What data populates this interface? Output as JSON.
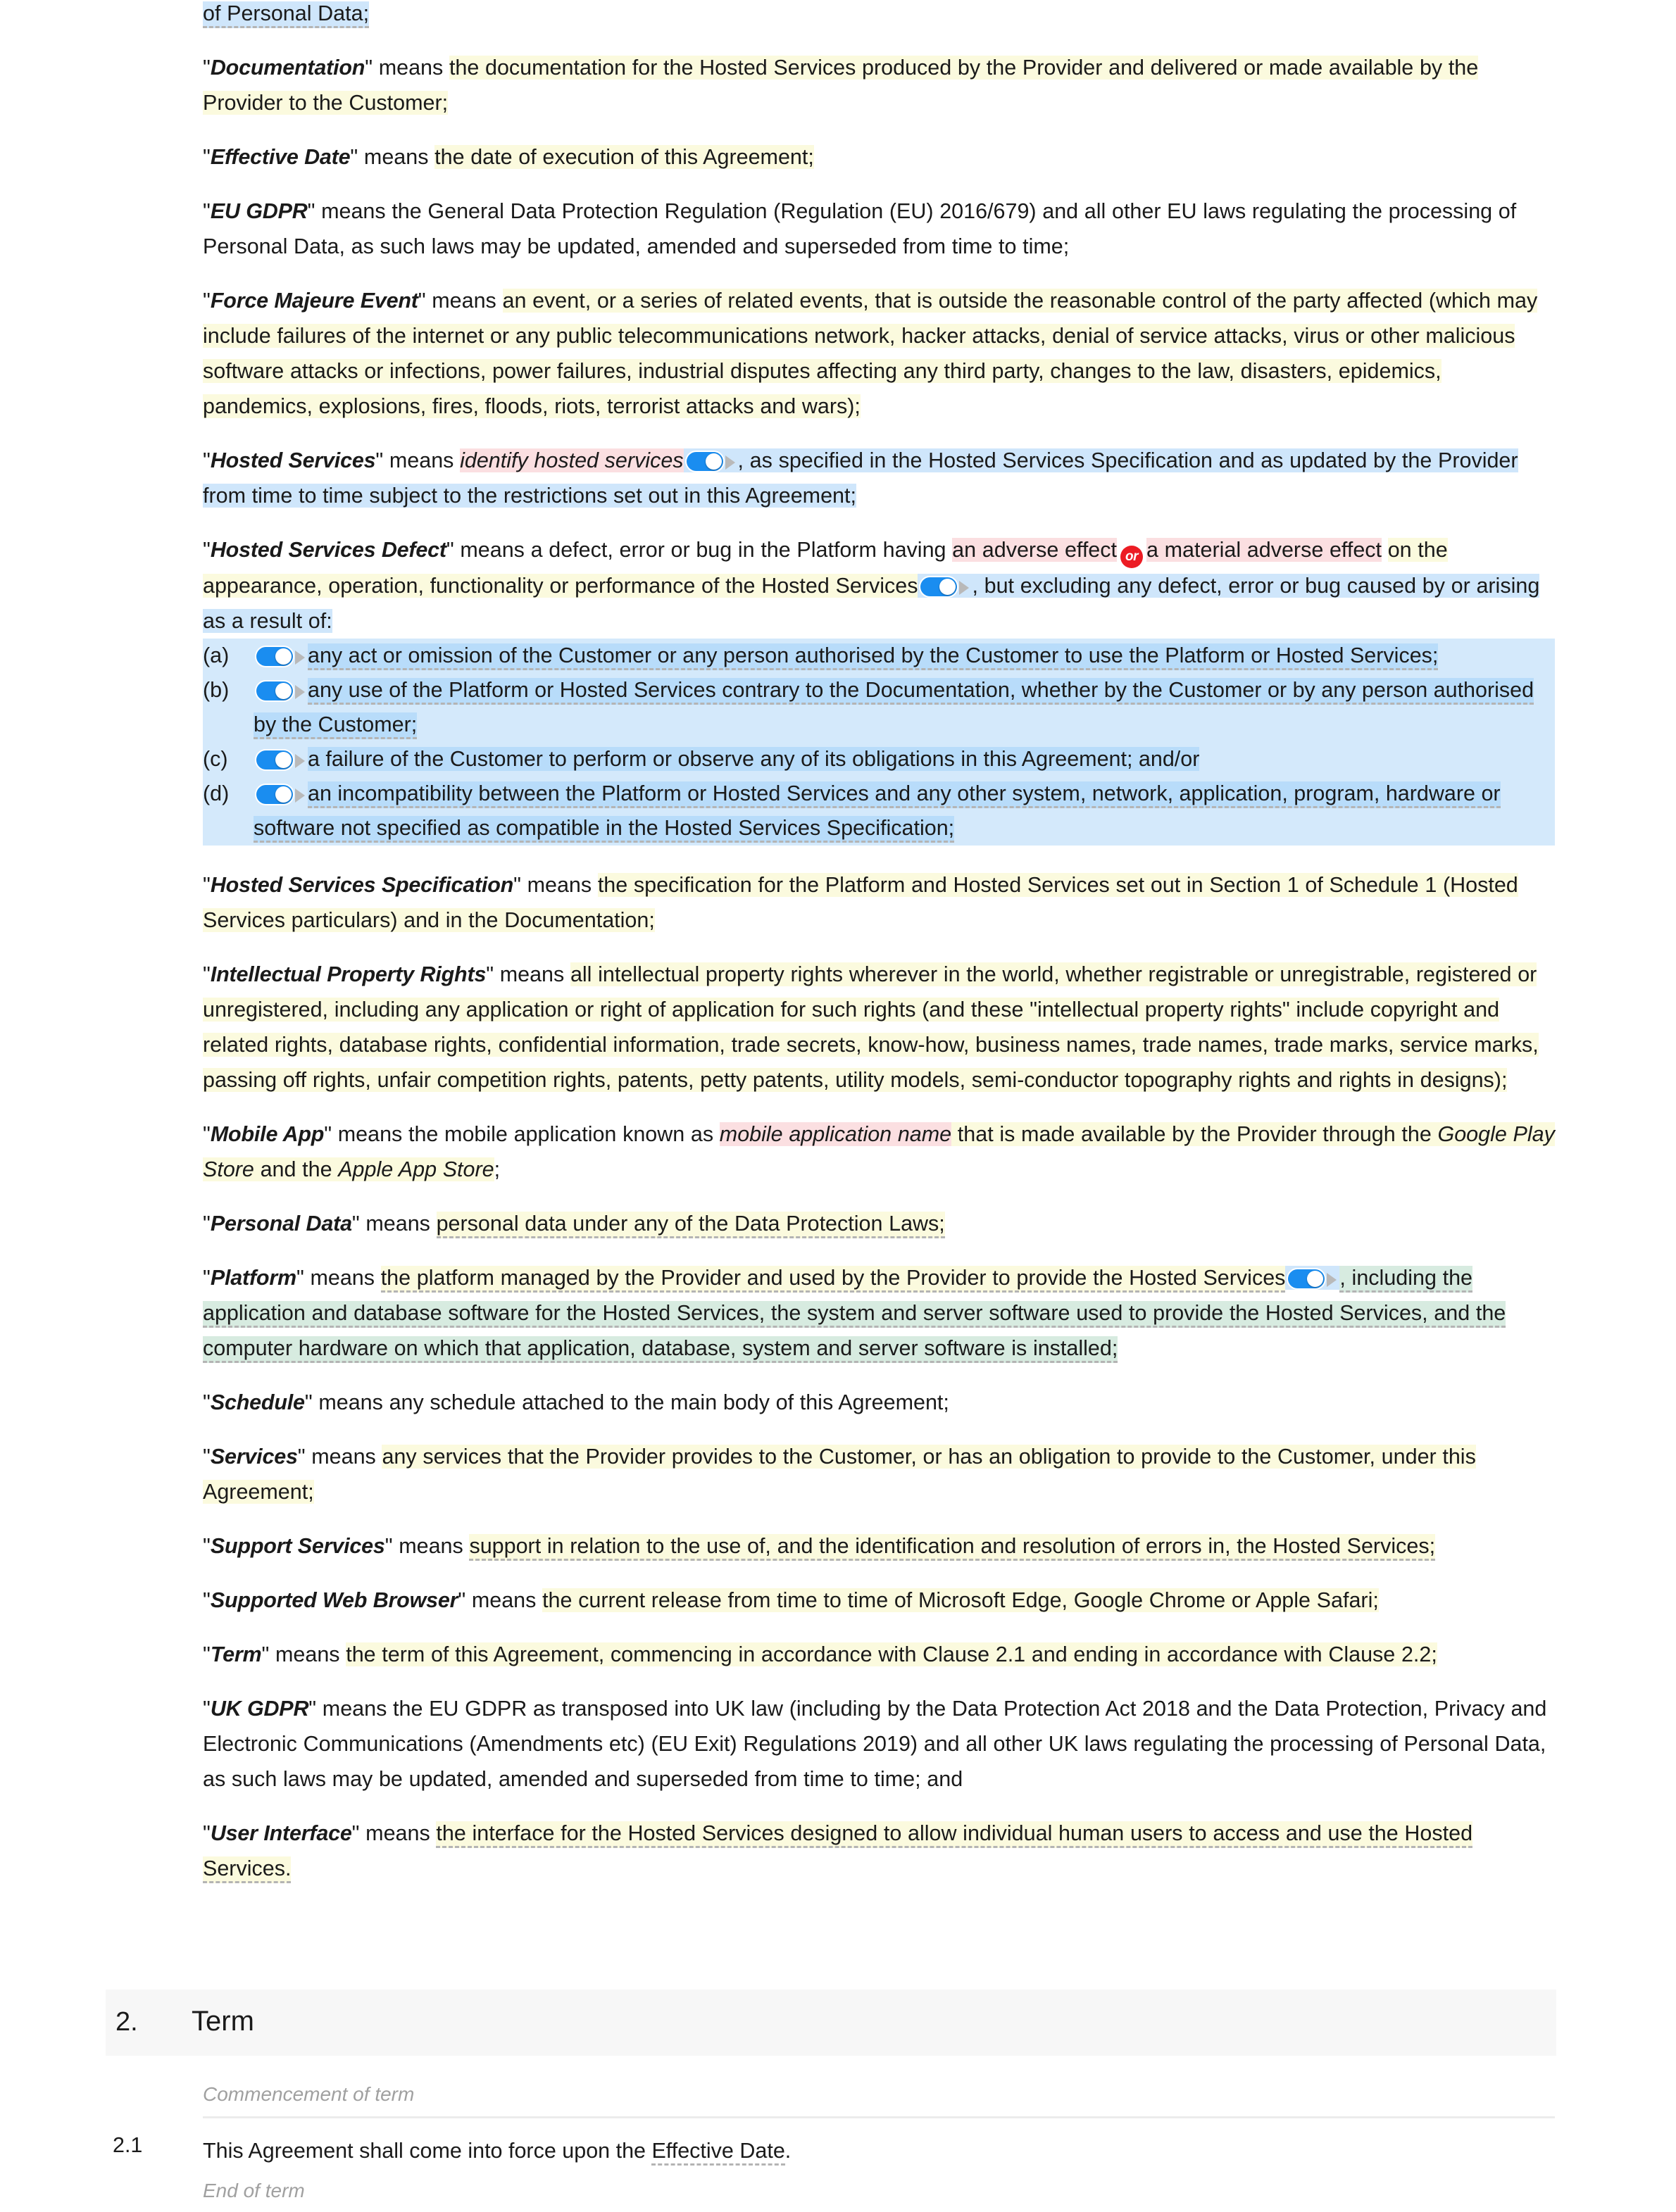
{
  "document": {
    "type": "legal-agreement-definitions",
    "continued_fragment": "of Personal Data;"
  },
  "definitions": [
    {
      "id": "documentation",
      "term": "Documentation",
      "lead": "\" means ",
      "text": "the documentation for the Hosted Services produced by the Provider and delivered or made available by the Provider to the Customer;"
    },
    {
      "id": "effective-date",
      "term": "Effective Date",
      "lead": "\" means ",
      "text": "the date of execution of this Agreement;"
    },
    {
      "id": "eu-gdpr",
      "term": "EU GDPR",
      "lead": "\" means ",
      "text": "the General Data Protection Regulation (Regulation (EU) 2016/679) and all other EU laws regulating the processing of Personal Data, as such laws may be updated, amended and superseded from time to time;"
    },
    {
      "id": "force-majeure-event",
      "term": "Force Majeure Event",
      "lead": "\" means ",
      "text": "an event, or a series of related events, that is outside the reasonable control of the party affected (which may include failures of the internet or any public telecommunications network, hacker attacks, denial of service attacks, virus or other malicious software attacks or infections, power failures, industrial disputes affecting any third party, changes to the law, disasters, epidemics, pandemics, explosions, fires, floods, riots, terrorist attacks and wars);"
    },
    {
      "id": "hosted-services",
      "term": "Hosted Services",
      "lead": "\" means ",
      "placeholder": "identify hosted services",
      "text_after_toggle": ", as specified in the Hosted Services Specification and as updated by the Provider from time to time subject to the restrictions set out in this Agreement;"
    },
    {
      "id": "hosted-services-defect",
      "term": "Hosted Services Defect",
      "lead": "\" means ",
      "part1": "a defect, error or bug in the Platform having ",
      "adverse_a": "an adverse effect",
      "or_badge": "or",
      "adverse_b": "a material adverse effect",
      "part2": "on the appearance, operation, functionality or performance of the Hosted Services",
      "part3": ", but excluding any defect, error or bug caused by or arising as a result of:",
      "sublist": [
        {
          "label": "(a)",
          "text": "any act or omission of the Customer or any person authorised by the Customer to use the Platform or Hosted Services;"
        },
        {
          "label": "(b)",
          "text": "any use of the Platform or Hosted Services contrary to the Documentation, whether by the Customer or by any person authorised by the Customer;"
        },
        {
          "label": "(c)",
          "text": "a failure of the Customer to perform or observe any of its obligations in this Agreement; and/or"
        },
        {
          "label": "(d)",
          "text": "an incompatibility between the Platform or Hosted Services and any other system, network, application, program, hardware or software not specified as compatible in the Hosted Services Specification;"
        }
      ]
    },
    {
      "id": "hosted-services-specification",
      "term": "Hosted Services Specification",
      "lead": "\" means ",
      "text": "the specification for the Platform and Hosted Services set out in Section 1 of Schedule 1 (Hosted Services particulars) and in the Documentation;"
    },
    {
      "id": "intellectual-property-rights",
      "term": "Intellectual Property Rights",
      "lead": "\" means ",
      "text": "all intellectual property rights wherever in the world, whether registrable or unregistrable, registered or unregistered, including any application or right of application for such rights (and these \"intellectual property rights\" include copyright and related rights, database rights, confidential information, trade secrets, know-how, business names, trade names, trade marks, service marks, passing off rights, unfair competition rights, patents, petty patents, utility models, semi-conductor topography rights and rights in designs);"
    },
    {
      "id": "mobile-app",
      "term": "Mobile App",
      "lead": "\" means the mobile application known as ",
      "placeholder": "mobile application name",
      "text_mid": " that is made available by the Provider through the ",
      "store_1": "Google Play Store",
      "text_join": " and the ",
      "store_2": "Apple App Store",
      "text_end": ";"
    },
    {
      "id": "personal-data",
      "term": "Personal Data",
      "lead": "\" means ",
      "text": "personal data under any of the Data Protection Laws;"
    },
    {
      "id": "platform",
      "term": "Platform",
      "lead": "\" means ",
      "text_before": "the platform managed by the Provider and used by the Provider to provide the Hosted Services",
      "text_after": ", including the application and database software for the Hosted Services, the system and server software used to provide the Hosted Services, and the computer hardware on which that application, database, system and server software is installed;"
    },
    {
      "id": "schedule",
      "term": "Schedule",
      "lead": "\" means ",
      "text": "any schedule attached to the main body of this Agreement;"
    },
    {
      "id": "services",
      "term": "Services",
      "lead": "\" means ",
      "text": "any services that the Provider provides to the Customer, or has an obligation to provide to the Customer, under this Agreement;"
    },
    {
      "id": "support-services",
      "term": "Support Services",
      "lead": "\" means ",
      "text": "support in relation to the use of, and the identification and resolution of errors in, the Hosted Services;"
    },
    {
      "id": "supported-web-browser",
      "term": "Supported Web Browser",
      "lead": "\" means ",
      "text": "the current release from time to time of Microsoft Edge, Google Chrome or Apple Safari;"
    },
    {
      "id": "term",
      "term": "Term",
      "lead": "\" means ",
      "text": "the term of this Agreement, commencing in accordance with Clause 2.1 and ending in accordance with Clause 2.2;"
    },
    {
      "id": "uk-gdpr",
      "term": "UK GDPR",
      "lead": "\" means ",
      "text": "the EU GDPR as transposed into UK law (including by the Data Protection Act 2018 and the Data Protection, Privacy and Electronic Communications (Amendments etc) (EU Exit) Regulations 2019) and all other UK laws regulating the processing of Personal Data, as such laws may be updated, amended and superseded from time to time; and"
    },
    {
      "id": "user-interface",
      "term": "User Interface",
      "lead": "\" means ",
      "text": "the interface for the Hosted Services designed to allow individual human users to access and use the Hosted Services."
    }
  ],
  "section": {
    "number": "2.",
    "title": "Term",
    "note_commencement": "Commencement of term",
    "clause_2_1_number": "2.1",
    "clause_2_1_text_a": "This Agreement shall come into force upon the ",
    "clause_2_1_term": "Effective Date",
    "clause_2_1_text_b": ".",
    "note_end": "End of term"
  },
  "colors": {
    "highlight_yellow": "#fbfade",
    "highlight_blue": "#cfe6fb",
    "highlight_blue_strong": "#b8dcfa",
    "highlight_pink": "#fbdfe1",
    "highlight_green": "#d7ebe0",
    "toggle_on": "#1a8df0",
    "or_badge": "#ec1c24",
    "section_band": "#f7f7f7",
    "note_text": "#a0a0a0",
    "dashed_underline": "#b4b4b4"
  }
}
